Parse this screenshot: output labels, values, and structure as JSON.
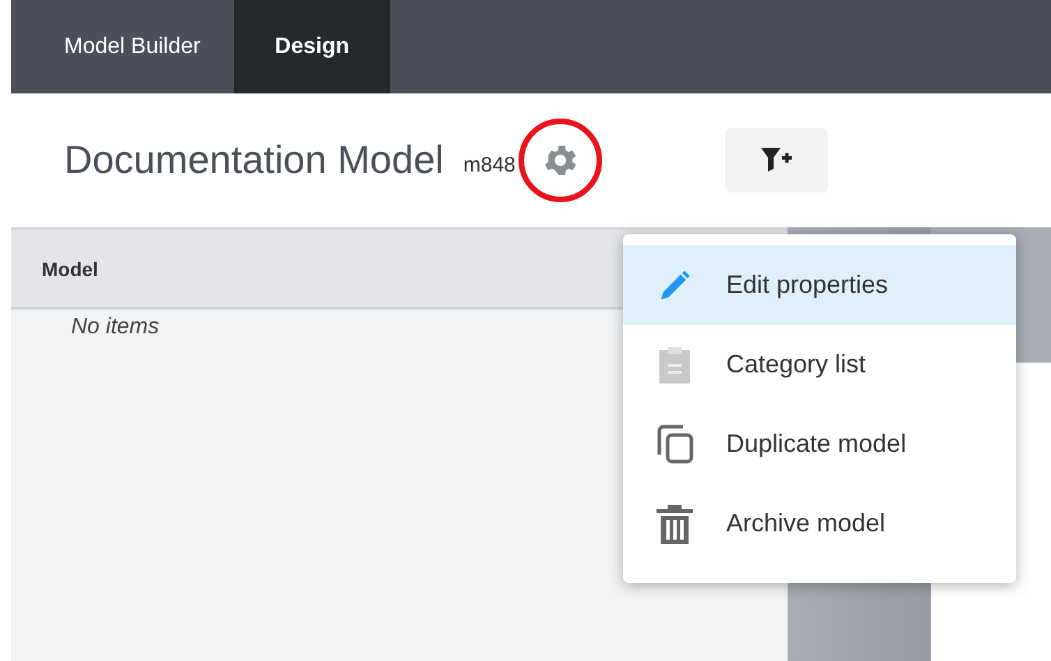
{
  "nav": {
    "tabs": [
      {
        "label": "Model Builder",
        "selected": false
      },
      {
        "label": "Design",
        "selected": true
      }
    ]
  },
  "header": {
    "title": "Documentation Model",
    "code": "m848",
    "highlighted": true
  },
  "table": {
    "columns": [
      "Model"
    ],
    "empty_text": "No items"
  },
  "menu": {
    "items": [
      {
        "label": "Edit properties",
        "kind": "pencil",
        "selected": true
      },
      {
        "label": "Category list",
        "kind": "clipboard",
        "selected": false
      },
      {
        "label": "Duplicate model",
        "kind": "copy",
        "selected": false
      },
      {
        "label": "Archive model",
        "kind": "trash",
        "selected": false
      }
    ]
  }
}
